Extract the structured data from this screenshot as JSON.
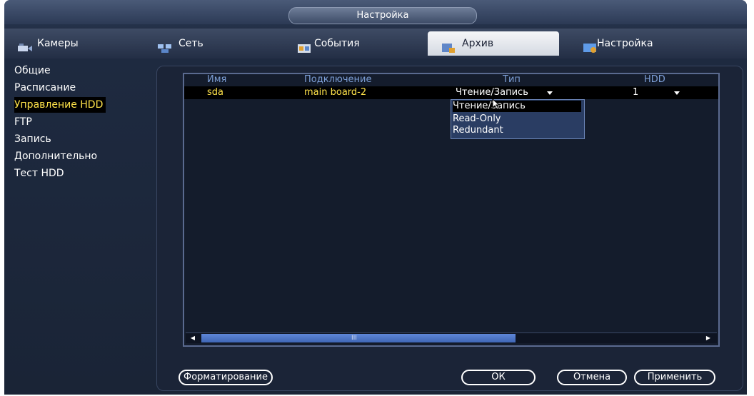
{
  "window": {
    "title": "Настройка"
  },
  "tabs": [
    {
      "label": "Камеры",
      "icon": "camera-icon"
    },
    {
      "label": "Сеть",
      "icon": "network-icon"
    },
    {
      "label": "События",
      "icon": "events-icon"
    },
    {
      "label": "Архив",
      "icon": "archive-icon",
      "active": true
    },
    {
      "label": "Настройка",
      "icon": "settings-icon"
    }
  ],
  "sidebar": {
    "items": [
      {
        "label": "Общие"
      },
      {
        "label": "Расписание"
      },
      {
        "label": "Управление HDD",
        "active": true
      },
      {
        "label": "FTP"
      },
      {
        "label": "Запись"
      },
      {
        "label": "Дополнительно"
      },
      {
        "label": "Тест HDD"
      }
    ]
  },
  "table": {
    "columns": [
      "Имя",
      "Подключение",
      "Тип",
      "HDD"
    ],
    "rows": [
      {
        "name": "sda",
        "connection": "main board-2",
        "type": "Чтение/Запись",
        "hdd": "1"
      }
    ]
  },
  "type_dropdown": {
    "options": [
      "Чтение/Запись",
      "Read-Only",
      "Redundant"
    ],
    "selected": "Чтение/Запись"
  },
  "scrollbar": {
    "thumb_label": "III"
  },
  "buttons": {
    "format": "Форматирование",
    "ok": "ОК",
    "cancel": "Отмена",
    "apply": "Применить"
  },
  "colors": {
    "accent_yellow": "#ffe34a",
    "header_blue": "#7d9fd6",
    "thumb_blue": "#4f76c8"
  }
}
